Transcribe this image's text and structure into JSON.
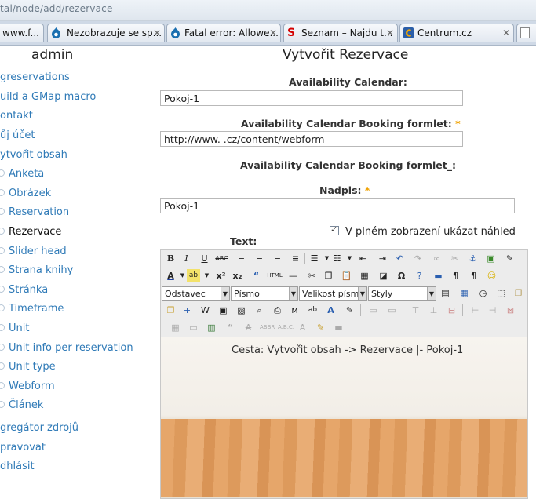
{
  "browser": {
    "address": "tal/node/add/rezervace",
    "tabs": [
      {
        "label": "www.f..."
      },
      {
        "label": "Nezobrazuje se sp..."
      },
      {
        "label": "Fatal error: Allowe..."
      },
      {
        "label": "Seznam – Najdu t..."
      },
      {
        "label": "Centrum.cz"
      }
    ],
    "tab_close": "✕"
  },
  "sidebar": {
    "user": "admin",
    "items": [
      "greservations",
      "uild a GMap macro",
      "ontakt",
      "ůj účet",
      "ytvořit obsah"
    ],
    "subitems": [
      "Anketa",
      "Obrázek",
      "Reservation",
      "Rezervace",
      "Slider head",
      "Strana knihy",
      "Stránka",
      "Timeframe",
      "Unit",
      "Unit info per reservation",
      "Unit type",
      "Webform",
      "Článek"
    ],
    "bottom_items": [
      "gregátor zdrojů",
      "pravovat",
      "dhlásit"
    ]
  },
  "main": {
    "title": "Vytvořit Rezervace",
    "availability_calendar_label": "Availability Calendar:",
    "availability_calendar_value": "Pokoj-1",
    "booking_formlet_label": "Availability Calendar Booking formlet:",
    "booking_formlet_value": "http://www.             .cz/content/webform",
    "booking_formlet2_label": "Availability Calendar Booking formlet_:",
    "nadpis_label": "Nadpis:",
    "nadpis_value": "Pokoj-1",
    "required_mark": "*",
    "text_label": "Text:",
    "preview_checkbox_label": "V plném zobrazení ukázat náhled"
  },
  "editor": {
    "format_combo": "Odstavec",
    "font_combo": "Písmo",
    "size_combo": "Velikost písma",
    "style_combo": "Styly",
    "breadcrumb": "Cesta: Vytvořit obsah ->  Rezervace |- Pokoj-1"
  }
}
